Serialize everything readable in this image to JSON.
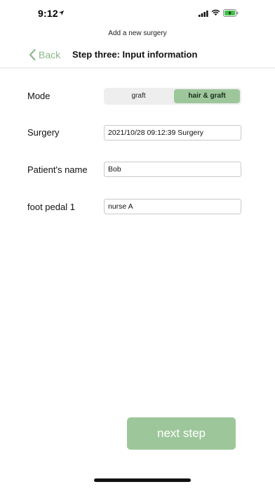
{
  "status_bar": {
    "time": "9:12",
    "location_icon": "location-arrow-icon",
    "signal_icon": "cellular-signal-icon",
    "wifi_icon": "wifi-icon",
    "battery_icon": "battery-charging-icon",
    "battery_color": "#3fc14a"
  },
  "header": {
    "subtitle": "Add a new surgery",
    "back_label": "Back",
    "title": "Step three: Input information"
  },
  "form": {
    "mode": {
      "label": "Mode",
      "options": [
        "graft",
        "hair & graft"
      ],
      "selected": "hair & graft"
    },
    "surgery": {
      "label": "Surgery",
      "value": "2021/10/28 09:12:39 Surgery"
    },
    "patient_name": {
      "label": "Patient's name",
      "value": "Bob"
    },
    "foot_pedal": {
      "label": "foot pedal 1",
      "value": "nurse A"
    }
  },
  "actions": {
    "next_label": "next step"
  },
  "colors": {
    "accent": "#9dc79b",
    "back_text": "#8ab98a"
  }
}
